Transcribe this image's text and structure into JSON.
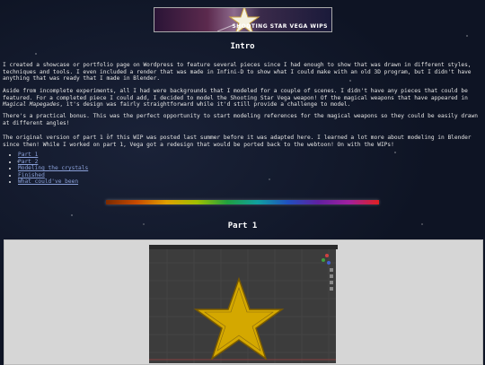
{
  "banner": {
    "text": "SHOOTING STAR VEGA WIPS"
  },
  "intro": {
    "title": "Intro",
    "p1": "I created a showcase or portfolio page on Wordpress to feature several pieces since I had enough to show that was drawn in different styles, techniques and tools. I even included a render that was made in Infini-D to show what I could make with an old 3D program, but I didn't have anything that was ready that I made in Blender.",
    "p2_before": "Aside from incomplete experiments, all I had were backgrounds that I modeled for a couple of scenes. I didn't have any pieces that could be featured. For a completed piece I could add, I decided to model the Shooting Star Vega weapon! Of the magical weapons that have appeared in ",
    "p2_em": "Magical Mapegades",
    "p2_after": ", it's design was fairly straightforward while it'd still provide a challenge to model.",
    "p3": "There's a practical bonus. This was the perfect opportunity to start modeling references for the magical weapons so they could be easily drawn at different angles!",
    "p4": "The original version of part 1 of this WIP was posted last summer before it was adapted here. I learned a lot more about modeling in Blender since then! While I worked on part 1, Vega got a redesign that would be ported back to the webtoon! On with the WIPs!"
  },
  "toc": {
    "items": [
      "Part 1",
      "Part 2",
      "Modeling the crystals",
      "Finished",
      "What could've been"
    ]
  },
  "part1": {
    "title": "Part 1"
  },
  "colors": {
    "star_fill": "#d4a800",
    "star_stroke": "#7a5a00",
    "link": "#8aa0d8"
  }
}
